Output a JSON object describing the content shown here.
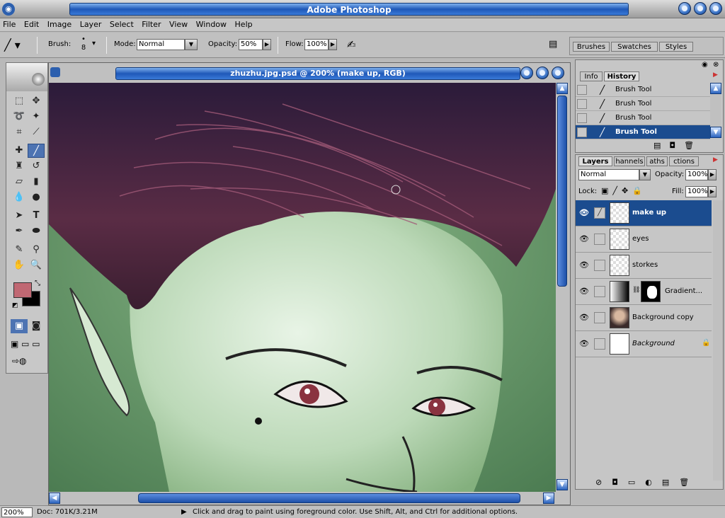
{
  "app": {
    "title": "Adobe Photoshop",
    "icon": "photoshop-eye-icon"
  },
  "menu": [
    "File",
    "Edit",
    "Image",
    "Layer",
    "Select",
    "Filter",
    "View",
    "Window",
    "Help"
  ],
  "options": {
    "brush_label": "Brush:",
    "brush_size": "8",
    "mode_label": "Mode:",
    "mode_value": "Normal",
    "opacity_label": "Opacity:",
    "opacity_value": "50%",
    "flow_label": "Flow:",
    "flow_value": "100%"
  },
  "palette_well": {
    "tabs": [
      "Brushes",
      "Swatches",
      "Styles"
    ]
  },
  "toolbox": {
    "foreground_color": "#c06873",
    "background_color": "#000000"
  },
  "document": {
    "title": "zhuzhu.jpg.psd @ 200% (make up, RGB)"
  },
  "history": {
    "tabs": [
      "Info",
      "History"
    ],
    "active_tab": "History",
    "items": [
      {
        "label": "Brush Tool",
        "selected": false
      },
      {
        "label": "Brush Tool",
        "selected": false
      },
      {
        "label": "Brush Tool",
        "selected": false
      },
      {
        "label": "Brush Tool",
        "selected": true
      }
    ]
  },
  "layers": {
    "tabs": [
      "Layers",
      "Channels",
      "Paths",
      "Actions"
    ],
    "visible_tabs": [
      "Layers",
      "hannels",
      "aths",
      "ctions"
    ],
    "blend_mode": "Normal",
    "opacity_label": "Opacity:",
    "opacity_value": "100%",
    "lock_label": "Lock:",
    "fill_label": "Fill:",
    "fill_value": "100%",
    "items": [
      {
        "name": "make up",
        "selected": true,
        "type": "transparent"
      },
      {
        "name": "eyes",
        "selected": false,
        "type": "transparent"
      },
      {
        "name": "storkes",
        "selected": false,
        "type": "transparent"
      },
      {
        "name": "Gradient...",
        "selected": false,
        "type": "gradient"
      },
      {
        "name": "Background copy",
        "selected": false,
        "type": "photo"
      },
      {
        "name": "Background",
        "selected": false,
        "type": "white",
        "locked": true
      }
    ]
  },
  "status": {
    "zoom": "200%",
    "doc": "Doc: 701K/3.21M",
    "hint": "Click and drag to paint using foreground color.  Use Shift, Alt, and Ctrl for additional options."
  },
  "colors": {
    "title_blue": "#1f58b8",
    "selection_blue": "#1b4c8f",
    "skin_green": "#b8d8b8",
    "hair": "#4a1f35"
  }
}
